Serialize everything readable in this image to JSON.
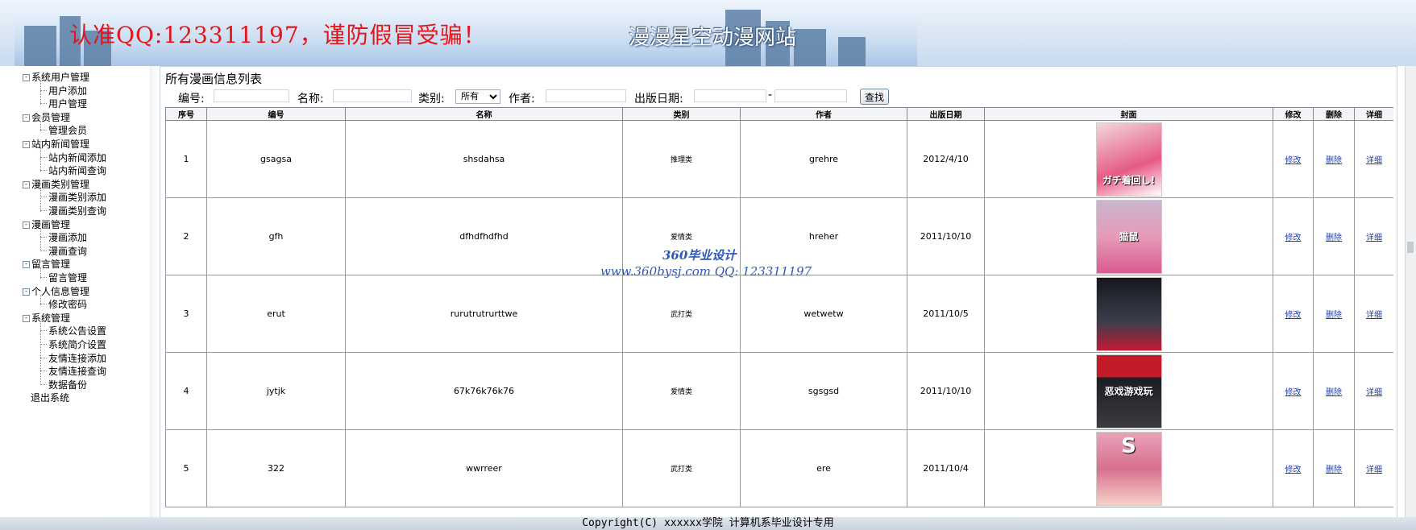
{
  "header": {
    "notice": "认准QQ:123311197，谨防假冒受骗！",
    "site_title": "漫漫星空动漫网站"
  },
  "sidebar": {
    "groups": [
      {
        "label": "系统用户管理",
        "children": [
          "用户添加",
          "用户管理"
        ]
      },
      {
        "label": "会员管理",
        "children": [
          "管理会员"
        ]
      },
      {
        "label": "站内新闻管理",
        "children": [
          "站内新闻添加",
          "站内新闻查询"
        ]
      },
      {
        "label": "漫画类别管理",
        "children": [
          "漫画类别添加",
          "漫画类别查询"
        ]
      },
      {
        "label": "漫画管理",
        "children": [
          "漫画添加",
          "漫画查询"
        ]
      },
      {
        "label": "留言管理",
        "children": [
          "留言管理"
        ]
      },
      {
        "label": "个人信息管理",
        "children": [
          "修改密码"
        ]
      },
      {
        "label": "系统管理",
        "children": [
          "系统公告设置",
          "系统简介设置",
          "友情连接添加",
          "友情连接查询",
          "数据备份"
        ]
      },
      {
        "label": "退出系统",
        "children": []
      }
    ]
  },
  "main": {
    "title": "所有漫画信息列表",
    "filters": {
      "code_label": "编号:",
      "name_label": "名称:",
      "category_label": "类别:",
      "category_selected": "所有",
      "author_label": "作者:",
      "date_label": "出版日期:",
      "date_sep": "-",
      "search_button": "查找"
    },
    "table": {
      "headers": [
        "序号",
        "编号",
        "名称",
        "类别",
        "作者",
        "出版日期",
        "封面",
        "修改",
        "删除",
        "详细"
      ],
      "rows": [
        {
          "no": "1",
          "code": "gsagsa",
          "name": "shsdahsa",
          "category": "推理类",
          "author": "grehre",
          "date": "2012/4/10",
          "edit": "修改",
          "delete": "删除",
          "detail": "详细",
          "cover_text": "ガチ着回し!"
        },
        {
          "no": "2",
          "code": "gfh",
          "name": "dfhdfhdfhd",
          "category": "爱情类",
          "author": "hreher",
          "date": "2011/10/10",
          "edit": "修改",
          "delete": "删除",
          "detail": "详细",
          "cover_text": "猫鼠"
        },
        {
          "no": "3",
          "code": "erut",
          "name": "rurutrutrurttwe",
          "category": "武打类",
          "author": "wetwetw",
          "date": "2011/10/5",
          "edit": "修改",
          "delete": "删除",
          "detail": "详细",
          "cover_text": ""
        },
        {
          "no": "4",
          "code": "jytjk",
          "name": "67k76k76k76",
          "category": "爱情类",
          "author": "sgsgsd",
          "date": "2011/10/10",
          "edit": "修改",
          "delete": "删除",
          "detail": "详细",
          "cover_text": "恶戏游戏玩"
        },
        {
          "no": "5",
          "code": "322",
          "name": "wwrreer",
          "category": "武打类",
          "author": "ere",
          "date": "2011/10/4",
          "edit": "修改",
          "delete": "删除",
          "detail": "详细",
          "cover_text": "S"
        }
      ]
    }
  },
  "watermark": {
    "line1": "360毕业设计",
    "line2": "www.360bysj.com     QQ:  123311197"
  },
  "footer": {
    "copyright": "Copyright(C) xxxxxx学院 计算机系毕业设计专用"
  },
  "colors": {
    "notice_red": "#e3151b",
    "link_blue": "#1a3eb5",
    "watermark_blue": "#2f57b8"
  }
}
